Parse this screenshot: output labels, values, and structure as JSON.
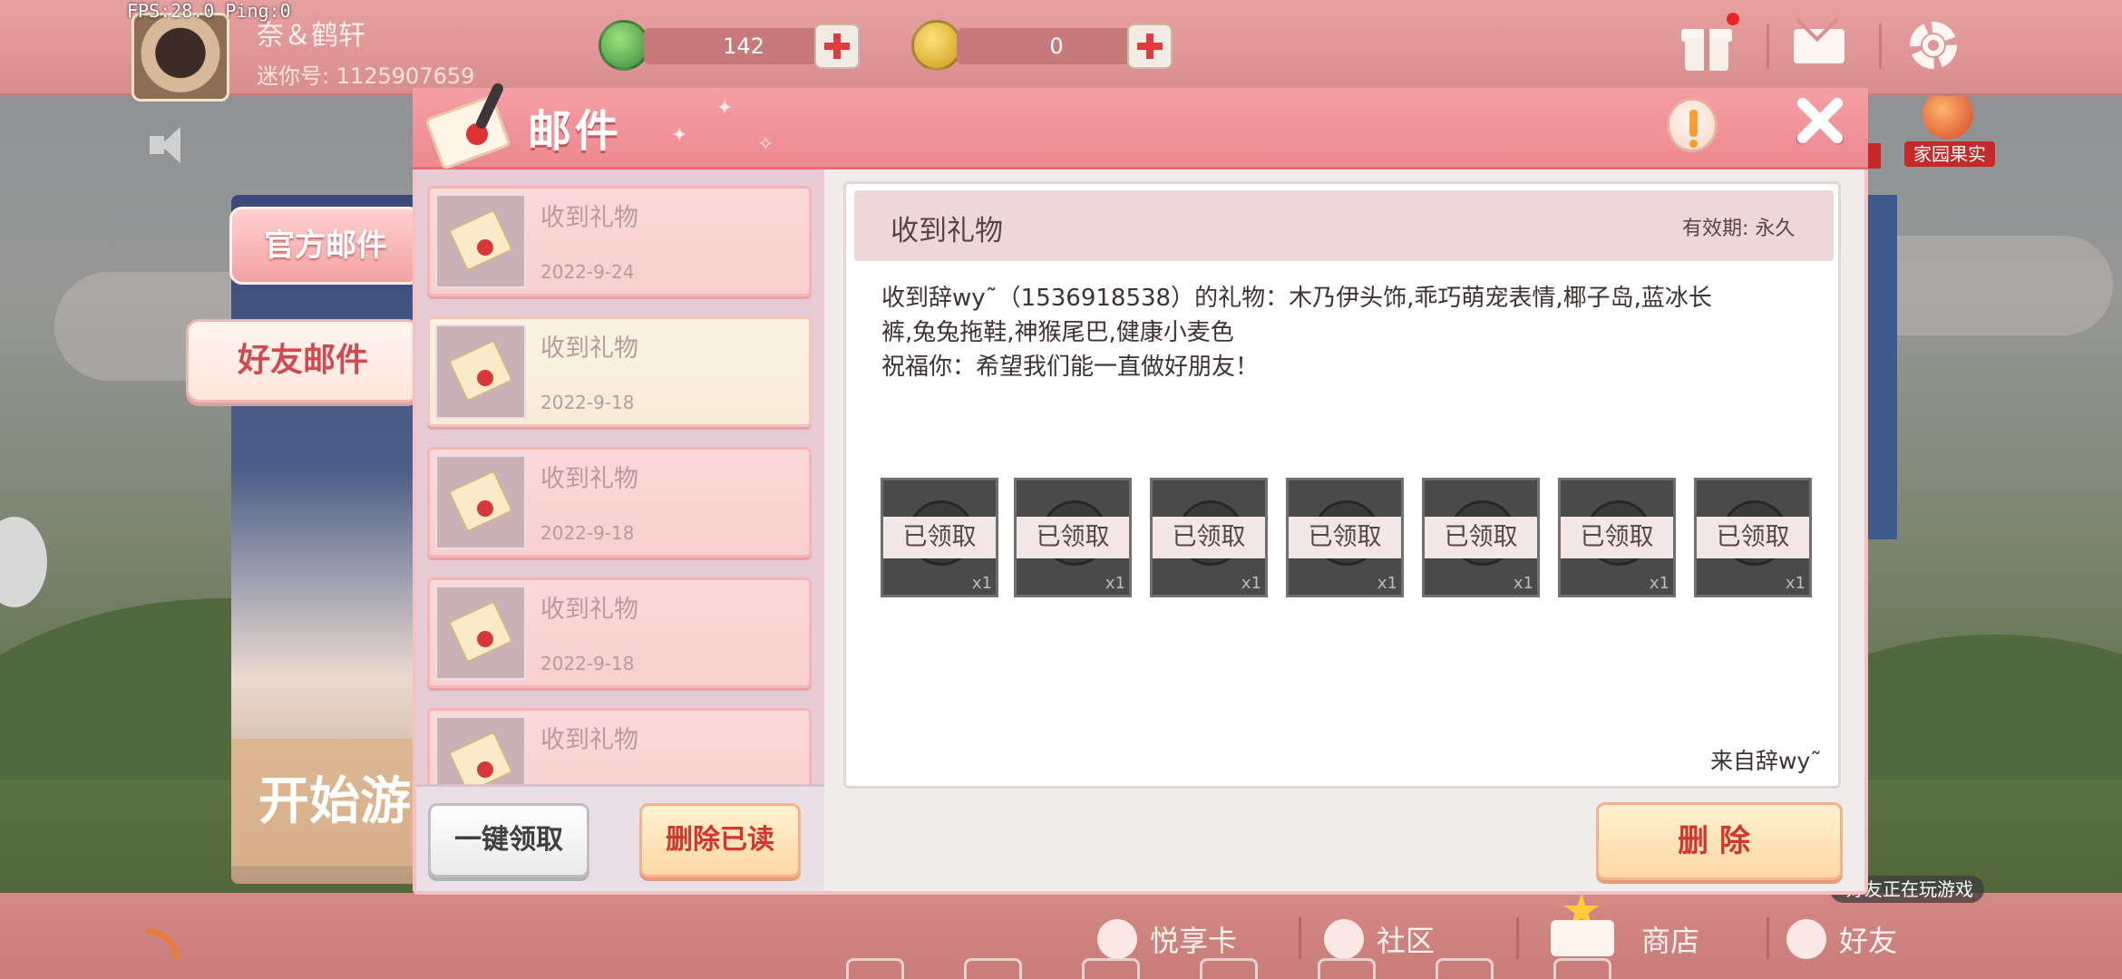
{
  "hud": {
    "fps": "FPS:28.0  Ping:0",
    "player_name": "奈＆鹤轩",
    "player_id": "迷你号: 1125907659",
    "green_currency": "142",
    "gold_currency": "0"
  },
  "side_tabs": {
    "official": "官方邮件",
    "friend": "好友邮件"
  },
  "background": {
    "start_game": "开始游",
    "home_fruit": "家园果实",
    "friend_playing": "好友正在玩游戏"
  },
  "modal": {
    "title": "邮件"
  },
  "mail_list": [
    {
      "subject": "收到礼物",
      "date": "2022-9-24",
      "selected": false
    },
    {
      "subject": "收到礼物",
      "date": "2022-9-18",
      "selected": true
    },
    {
      "subject": "收到礼物",
      "date": "2022-9-18",
      "selected": false
    },
    {
      "subject": "收到礼物",
      "date": "2022-9-18",
      "selected": false
    },
    {
      "subject": "收到礼物",
      "date": "",
      "selected": false
    }
  ],
  "list_buttons": {
    "collect_all": "一键领取",
    "delete_read": "删除已读"
  },
  "detail": {
    "title": "收到礼物",
    "validity": "有效期: 永久",
    "body": "收到辞wy˜（1536918538）的礼物：木乃伊头饰,乖巧萌宠表情,椰子岛,蓝冰长\n裤,兔兔拖鞋,神猴尾巴,健康小麦色\n祝福你：希望我们能一直做好朋友！",
    "items": [
      {
        "status": "已领取",
        "qty": "x1"
      },
      {
        "status": "已领取",
        "qty": "x1"
      },
      {
        "status": "已领取",
        "qty": "x1"
      },
      {
        "status": "已领取",
        "qty": "x1"
      },
      {
        "status": "已领取",
        "qty": "x1"
      },
      {
        "status": "已领取",
        "qty": "x1"
      },
      {
        "status": "已领取",
        "qty": "x1"
      }
    ],
    "sender": "来自辞wy˜",
    "delete_label": "删除"
  },
  "bottom_nav": {
    "vip": "悦享卡",
    "community": "社区",
    "shop": "商店",
    "friends": "好友"
  }
}
